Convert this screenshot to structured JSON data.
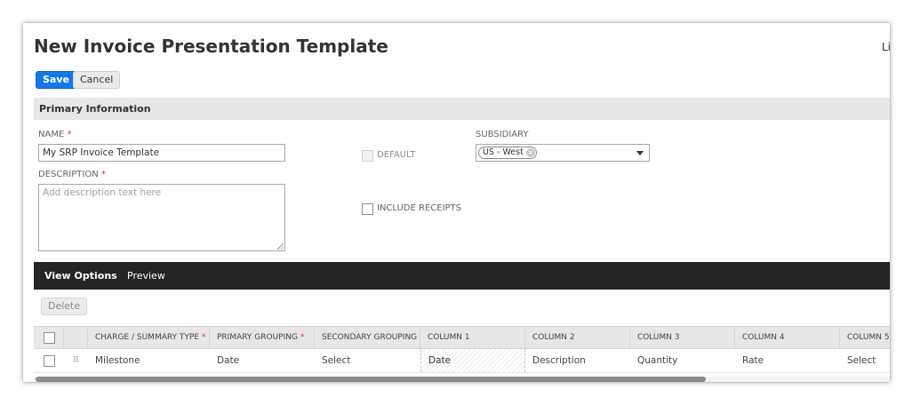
{
  "page": {
    "title": "New Invoice Presentation Template",
    "cut_text": "Li"
  },
  "actions": {
    "save_label": "Save",
    "cancel_label": "Cancel"
  },
  "primary_info": {
    "header": "Primary Information",
    "name_label": "NAME",
    "name_value": "My SRP Invoice Template",
    "description_label": "DESCRIPTION",
    "description_placeholder": "Add description text here",
    "default_label": "DEFAULT",
    "include_receipts_label": "INCLUDE RECEIPTS",
    "subsidiary_label": "SUBSIDIARY",
    "subsidiary_value": "US - West",
    "required_mark": "*",
    "chip_remove_glyph": "×"
  },
  "tabs": [
    {
      "label": "View Options",
      "active": true
    },
    {
      "label": "Preview",
      "active": false
    }
  ],
  "grid": {
    "delete_label": "Delete",
    "columns": [
      {
        "label": "CHARGE / SUMMARY TYPE",
        "required": true
      },
      {
        "label": "PRIMARY GROUPING",
        "required": true
      },
      {
        "label": "SECONDARY GROUPING",
        "required": false
      },
      {
        "label": "COLUMN 1",
        "required": false
      },
      {
        "label": "COLUMN 2",
        "required": false
      },
      {
        "label": "COLUMN 3",
        "required": false
      },
      {
        "label": "COLUMN 4",
        "required": false
      },
      {
        "label": "COLUMN 5",
        "required": false
      }
    ],
    "rows": [
      {
        "cells": [
          "Milestone",
          "Date",
          "Select",
          "Date",
          "Description",
          "Quantity",
          "Rate",
          "Select"
        ]
      }
    ]
  },
  "icons": {
    "drag_handle": "⠿",
    "dropdown": "chevron-down-icon"
  },
  "colors": {
    "primary_button": "#1479e6",
    "tab_bar": "#242424",
    "required": "#d7342e"
  }
}
